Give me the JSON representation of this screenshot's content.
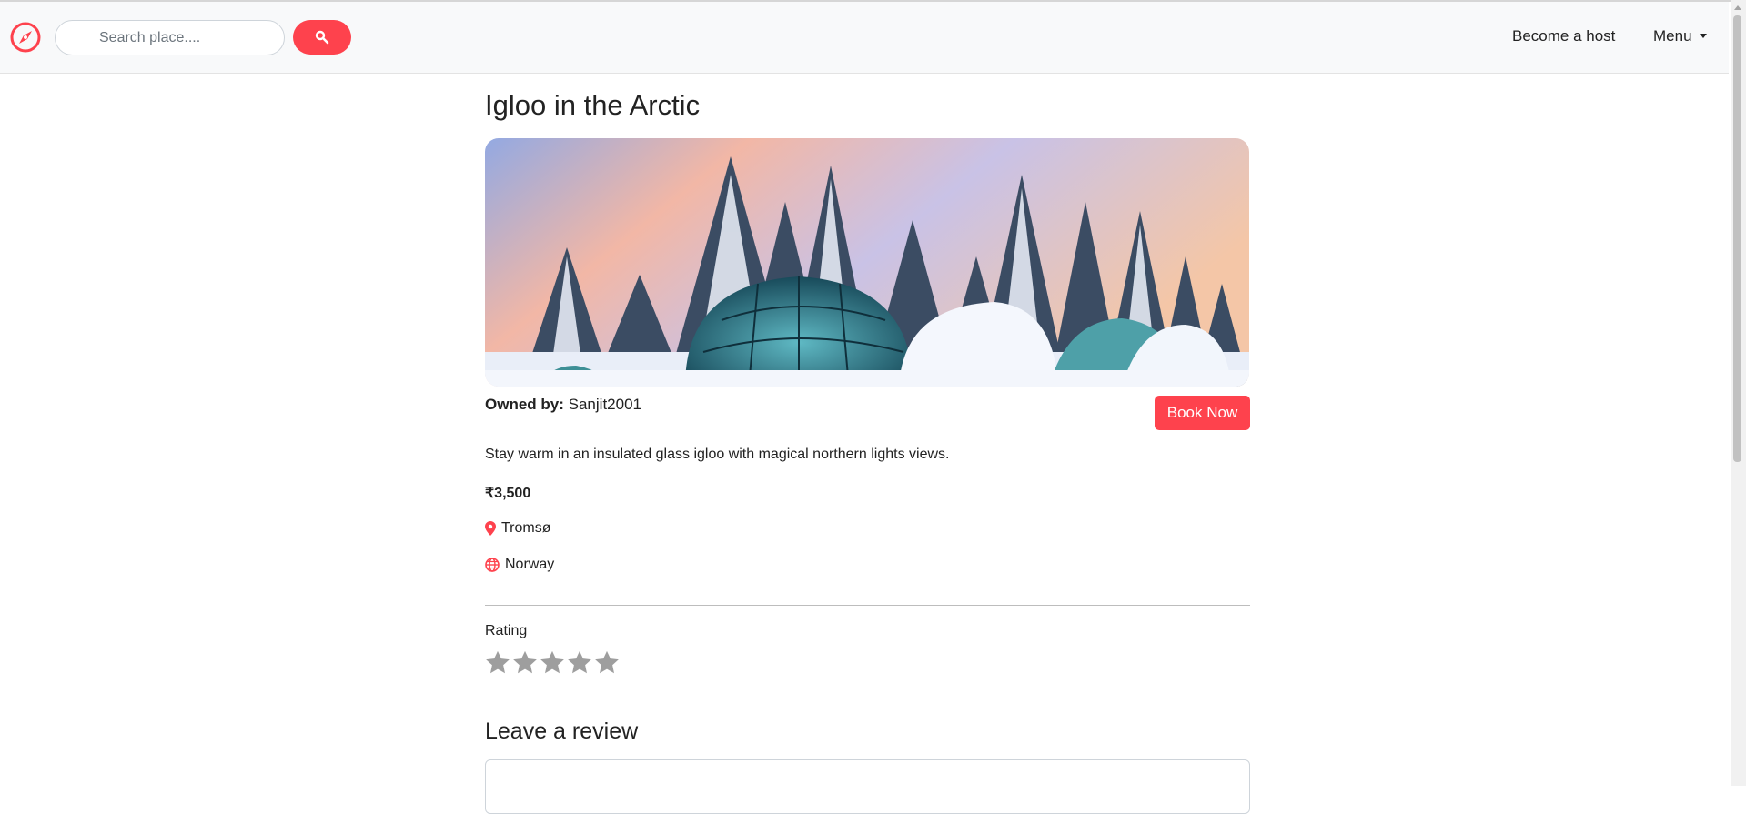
{
  "navbar": {
    "brand_icon": "compass-icon",
    "search": {
      "placeholder": "Search place....",
      "value": ""
    },
    "search_button_icon": "search-icon",
    "links": {
      "host": "Become a host",
      "menu": "Menu"
    }
  },
  "listing": {
    "title": "Igloo in the Arctic",
    "owner_label": "Owned by:",
    "owner_name": "Sanjit2001",
    "book_label": "Book Now",
    "description": "Stay warm in an insulated glass igloo with magical northern lights views.",
    "price": "₹3,500",
    "location": "Tromsø",
    "country": "Norway"
  },
  "rating": {
    "label": "Rating",
    "max_stars": 5,
    "selected": 0
  },
  "review": {
    "heading": "Leave a review",
    "value": ""
  },
  "colors": {
    "accent": "#fe424d",
    "star_inactive": "#9e9e9e",
    "navbar_bg": "#f8f9fa"
  }
}
